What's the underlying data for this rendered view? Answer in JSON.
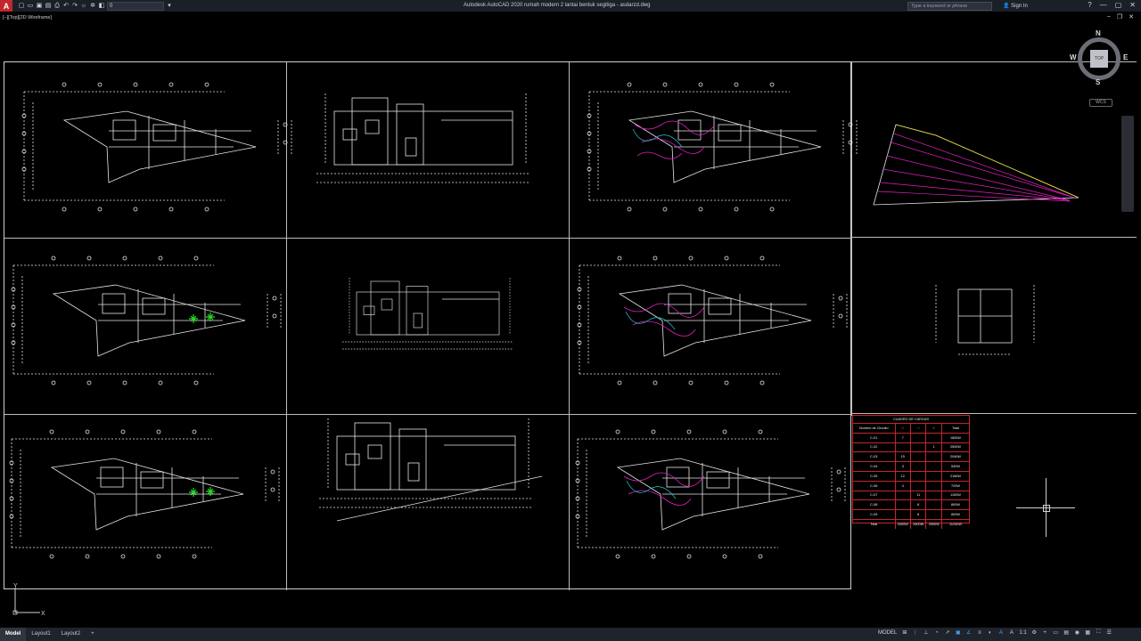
{
  "app": {
    "title": "Autodesk AutoCAD 2020   rumah modern 2 lantai bentuk segitiga - asdarzd.dwg",
    "search_placeholder": "Type a keyword or phrase",
    "sign_in": "Sign In",
    "layer_value": "0"
  },
  "viewport": {
    "label": "[–][Top][2D Wireframe]"
  },
  "viewcube": {
    "north": "N",
    "south": "S",
    "east": "E",
    "west": "W",
    "top": "TOP",
    "wcs": "WCS"
  },
  "ucs": {
    "y": "Y",
    "x": "X"
  },
  "load_table": {
    "title": "CUADRO DE CARGAS",
    "headers": [
      "Numero de Circuito",
      "",
      "",
      "",
      "Total"
    ],
    "rows": [
      [
        "C-01",
        "7",
        "",
        "",
        "1800W"
      ],
      [
        "C-02",
        "",
        "",
        "1",
        "2500W"
      ],
      [
        "C-03",
        "15",
        "",
        "",
        "2040W"
      ],
      [
        "C-04",
        "3",
        "",
        "",
        "540W"
      ],
      [
        "C-05",
        "12",
        "",
        "",
        "2160W"
      ],
      [
        "C-06",
        "4",
        "",
        "",
        "720W"
      ],
      [
        "C-07",
        "",
        "11",
        "",
        "1100W"
      ],
      [
        "C-08",
        "",
        "8",
        "",
        "800W"
      ],
      [
        "C-09",
        "",
        "8",
        "",
        "800W"
      ],
      [
        "Total",
        "3300W",
        "2600W",
        "2500W",
        "11240W"
      ]
    ]
  },
  "tabs": [
    {
      "label": "Model",
      "active": true
    },
    {
      "label": "Layout1",
      "active": false
    },
    {
      "label": "Layout2",
      "active": false
    },
    {
      "label": "+",
      "active": false
    }
  ],
  "status": {
    "model": "MODEL",
    "scale": "1:1"
  },
  "colors": {
    "background": "#000000",
    "accent_red": "#c1272d",
    "magenta": "#e020c0",
    "cyan": "#20d0e0",
    "green": "#20e020"
  }
}
